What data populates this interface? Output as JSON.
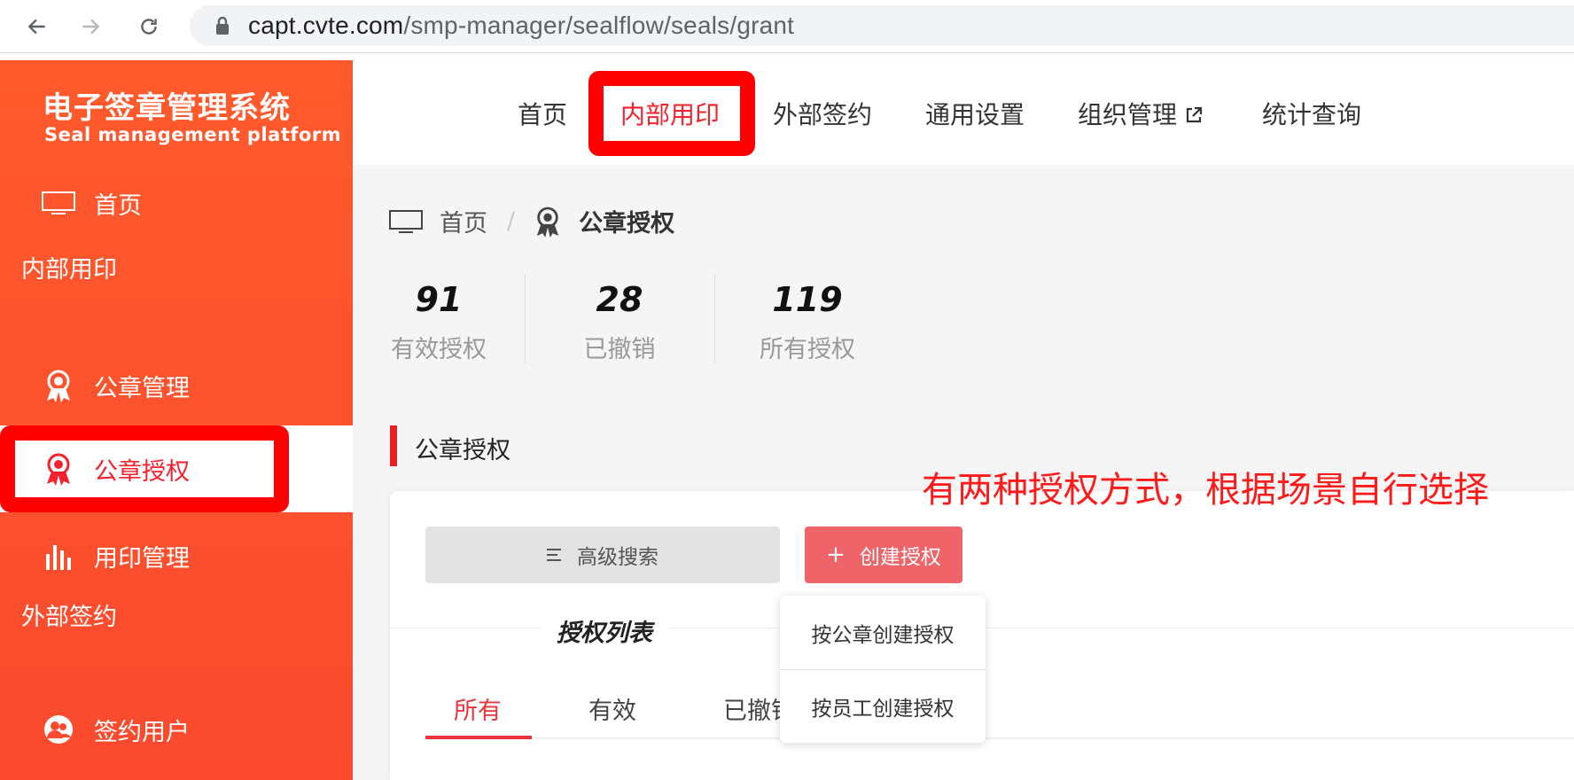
{
  "browser": {
    "url_host": "capt.cvte.com",
    "url_path": "/smp-manager/sealflow/seals/grant"
  },
  "sidebar": {
    "logo_cn": "电子签章管理系统",
    "logo_en": "Seal management platform",
    "home": "首页",
    "group_internal": "内部用印",
    "seal_manage": "公章管理",
    "seal_grant": "公章授权",
    "usage_manage": "用印管理",
    "group_external": "外部签约",
    "sign_users": "签约用户"
  },
  "topnav": {
    "items": [
      "首页",
      "内部用印",
      "外部签约",
      "通用设置",
      "组织管理",
      "统计查询"
    ],
    "active_index": 1
  },
  "breadcrumb": {
    "home": "首页",
    "sep": "/",
    "current": "公章授权"
  },
  "stats": [
    {
      "value": "91",
      "label": "有效授权"
    },
    {
      "value": "28",
      "label": "已撤销"
    },
    {
      "value": "119",
      "label": "所有授权"
    }
  ],
  "section": {
    "title": "公章授权",
    "advanced_search": "高级搜索",
    "create": "创建授权",
    "list_title": "授权列表",
    "tabs": [
      "所有",
      "有效",
      "已撤销"
    ]
  },
  "dropdown": {
    "options": [
      "按公章创建授权",
      "按员工创建授权"
    ]
  },
  "annotation": "有两种授权方式，根据场景自行选择",
  "colors": {
    "sidebar": "#ff5a2c",
    "accent": "#f5222d",
    "highlight": "#ff0000",
    "create_button": "#ee6469"
  }
}
